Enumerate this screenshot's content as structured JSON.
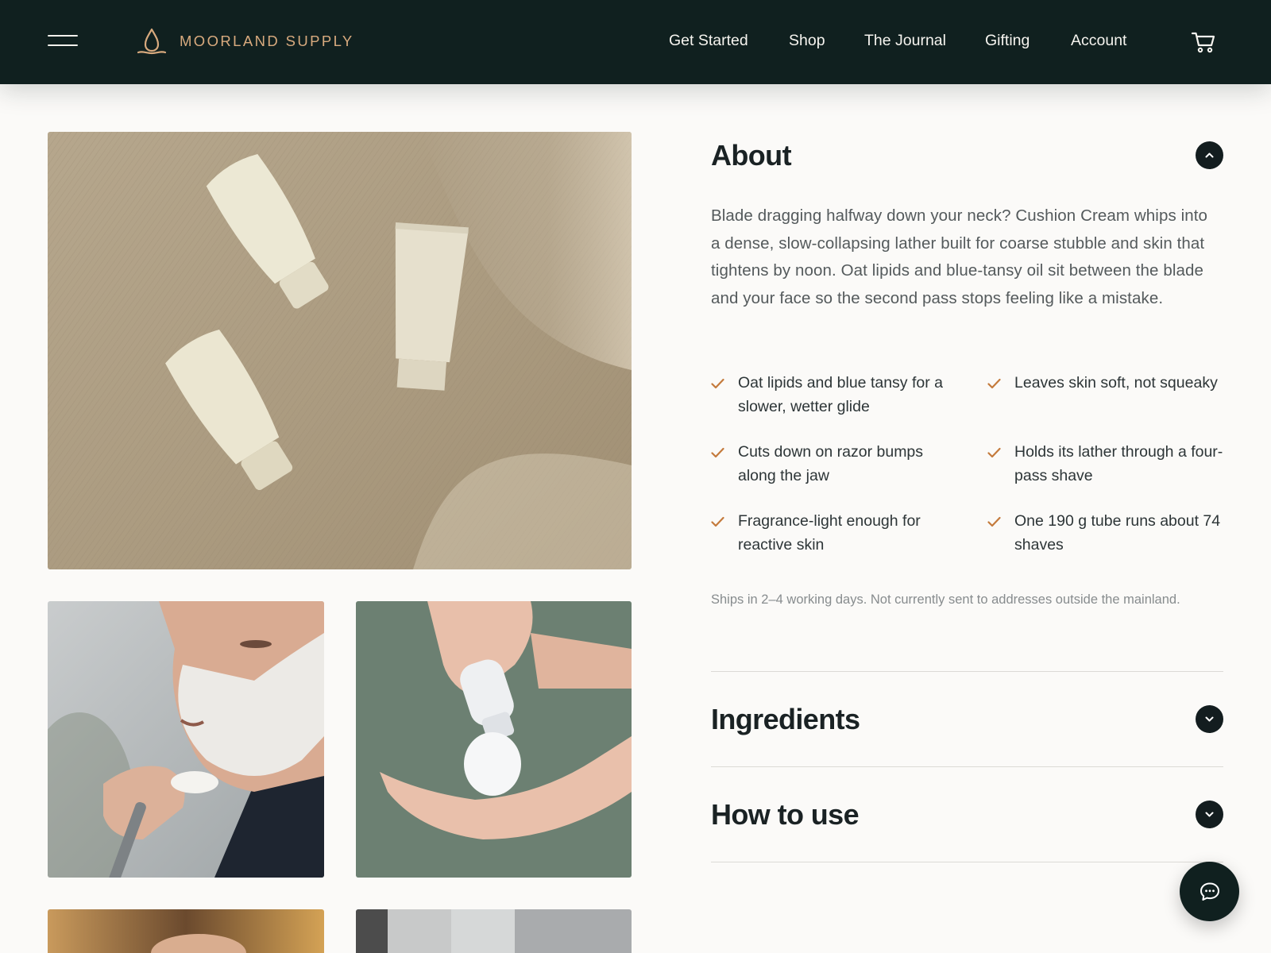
{
  "brand": {
    "name": "MOORLAND SUPPLY",
    "accent": "#d8aa7e",
    "header_bg": "#10201f"
  },
  "nav": {
    "items": [
      {
        "label": "Get Started"
      },
      {
        "label": "Shop"
      },
      {
        "label": "The Journal"
      },
      {
        "label": "Gifting"
      },
      {
        "label": "Account"
      }
    ],
    "menu_icon": "hamburger-icon",
    "cart_icon": "cart-icon"
  },
  "gallery": {
    "images": [
      {
        "subject": "three cream tubes on linen"
      },
      {
        "subject": "man shaving with lather"
      },
      {
        "subject": "foam dispensed into hand"
      },
      {
        "subject": "partial image"
      },
      {
        "subject": "partial image"
      }
    ]
  },
  "about": {
    "title": "About",
    "body": "Blade dragging halfway down your neck? Cushion Cream whips into a dense, slow-collapsing lather built for coarse stubble and skin that tightens by noon. Oat lipids and blue-tansy oil sit between the blade and your face so the second pass stops feeling like a mistake.",
    "benefits": [
      "Oat lipids and blue tansy for a slower, wetter glide",
      "Leaves skin soft, not squeaky",
      "Cuts down on razor bumps along the jaw",
      "Holds its lather through a four-pass shave",
      "Fragrance-light enough for reactive skin",
      "One 190 g tube runs about 74 shaves"
    ],
    "shipping_note": "Ships in 2–4 working days. Not currently sent to addresses outside the mainland.",
    "check_color": "#c47a3c"
  },
  "sections": [
    {
      "title": "Ingredients"
    },
    {
      "title": "How to use"
    }
  ],
  "chat": {
    "icon": "chat-bubble-icon"
  }
}
